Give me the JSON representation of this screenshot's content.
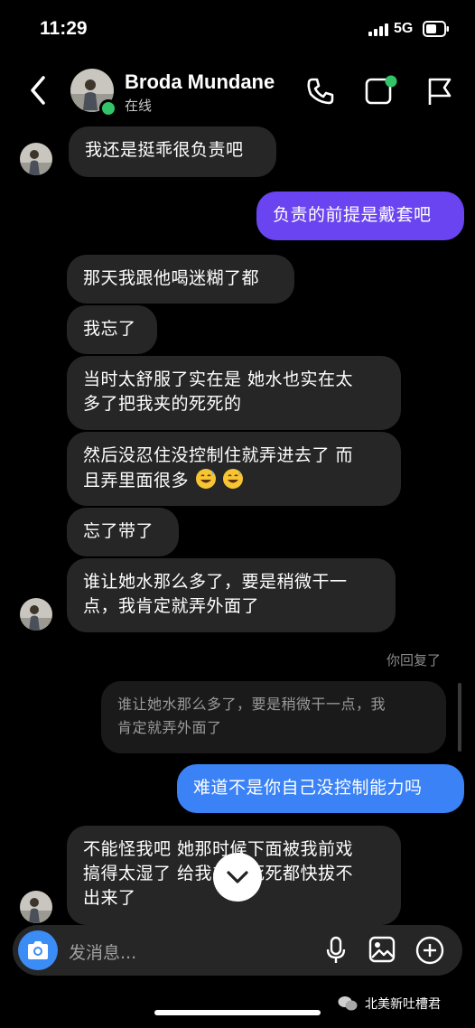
{
  "status_bar": {
    "time": "11:29",
    "network": "5G"
  },
  "header": {
    "contact_name": "Broda Mundane",
    "presence": "在线"
  },
  "messages": {
    "m1": "我还是挺乖很负责吧",
    "m2": "负责的前提是戴套吧",
    "m3": "那天我跟他喝迷糊了都",
    "m4": "我忘了",
    "m5_line1": "当时太舒服了实在是 她水也实在太",
    "m5_line2": "多了把我夹的死死的",
    "m6_line1": "然后没忍住没控制住就弄进去了 而",
    "m6_line2": "且弄里面很多",
    "m7": "忘了带了",
    "m8_line1": "谁让她水那么多了，要是稍微干一",
    "m8_line2": "点，我肯定就弄外面了",
    "reply_label": "你回复了",
    "quote_line1": "谁让她水那么多了，要是稍微干一点，我",
    "quote_line2": "肯定就弄外面了",
    "m9": "难道不是你自己没控制能力吗",
    "m10_line1": "不能怪我吧 她那时候下面被我前戏",
    "m10_line2": "搞得太湿了 给我夹的死死都快拔不",
    "m10_line3": "出来了"
  },
  "composer": {
    "placeholder": "发消息..."
  },
  "watermark": {
    "text": "北美新吐槽君"
  },
  "colors": {
    "outgoing_purple": "#6a44f0",
    "outgoing_blue": "#3b82f6",
    "incoming": "#262626",
    "online": "#33c46a"
  },
  "icons": [
    "back-icon",
    "phone-icon",
    "video-call-icon",
    "flag-icon",
    "camera-icon",
    "microphone-icon",
    "image-icon",
    "add-icon",
    "chevron-down-icon",
    "grinning-sweat-emoji"
  ]
}
